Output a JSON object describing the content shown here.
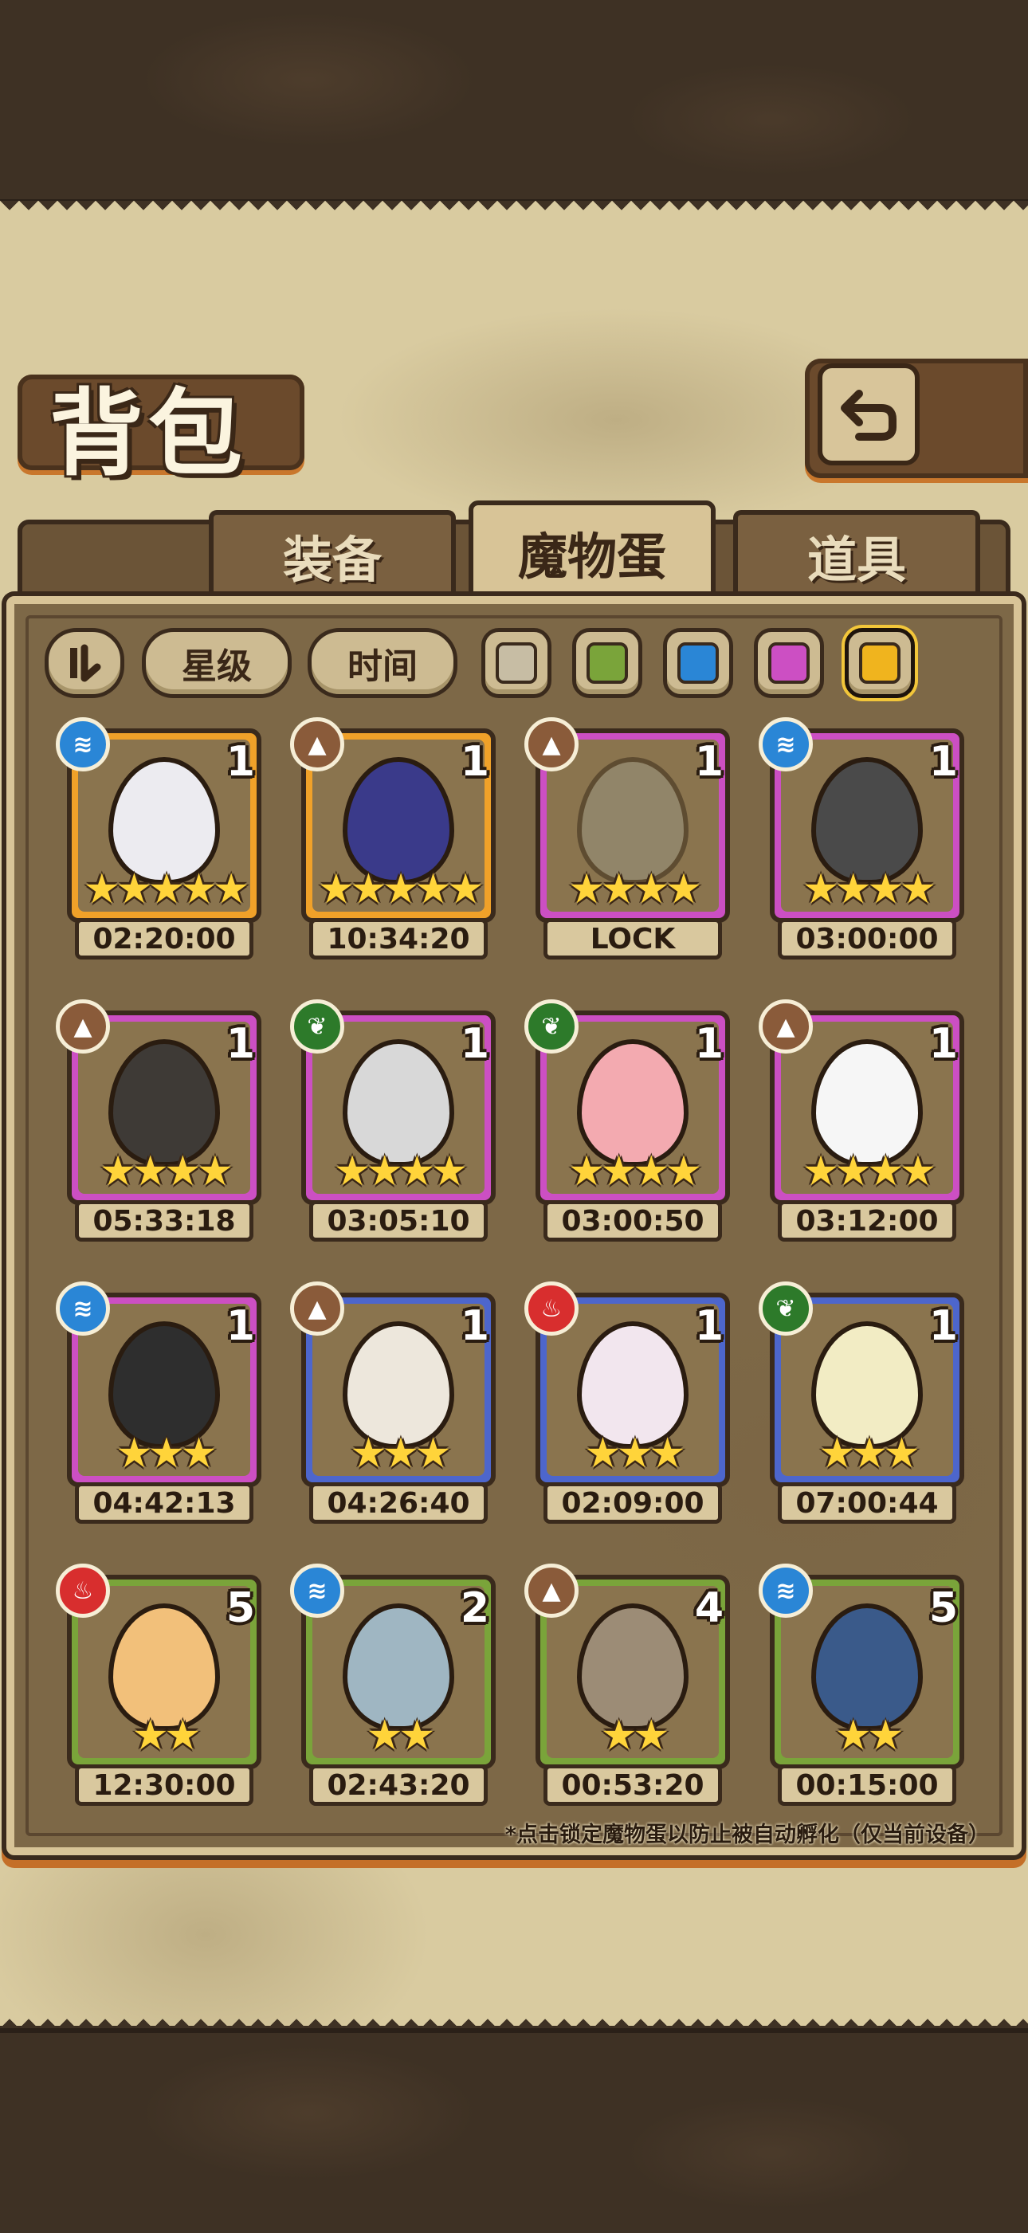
{
  "header": {
    "title": "背包",
    "back_icon": "back-arrow-icon"
  },
  "tabs": [
    {
      "label": "装备",
      "active": false
    },
    {
      "label": "魔物蛋",
      "active": true
    },
    {
      "label": "道具",
      "active": false
    }
  ],
  "filters": {
    "toggle_icon": "pause-sort-icon",
    "star_label": "星级",
    "time_label": "时间",
    "swatches": [
      {
        "name": "grey",
        "color": "#c7bda4"
      },
      {
        "name": "green",
        "color": "#7aa43a"
      },
      {
        "name": "blue",
        "color": "#2a86d6"
      },
      {
        "name": "pink",
        "color": "#cc4fc3"
      },
      {
        "name": "gold",
        "color": "#f0b41e",
        "selected": true
      }
    ]
  },
  "eggs": [
    {
      "element": "water",
      "rarity": "gold",
      "count": "1",
      "stars": "★★★★★",
      "timer": "02:20:00",
      "egg_color": "#ecebf0"
    },
    {
      "element": "earth",
      "rarity": "gold",
      "count": "1",
      "stars": "★★★★★",
      "timer": "10:34:20",
      "egg_color": "#3a3a8a"
    },
    {
      "element": "earth",
      "rarity": "purple",
      "count": "1",
      "stars": "★★★★",
      "timer": "LOCK",
      "egg_color": "#9a9a8a",
      "locked": true
    },
    {
      "element": "water",
      "rarity": "purple",
      "count": "1",
      "stars": "★★★★",
      "timer": "03:00:00",
      "egg_color": "#4a4a4a"
    },
    {
      "element": "earth",
      "rarity": "purple",
      "count": "1",
      "stars": "★★★★",
      "timer": "05:33:18",
      "egg_color": "#3e3a36"
    },
    {
      "element": "nature",
      "rarity": "purple",
      "count": "1",
      "stars": "★★★★",
      "timer": "03:05:10",
      "egg_color": "#d8d8d8"
    },
    {
      "element": "nature",
      "rarity": "purple",
      "count": "1",
      "stars": "★★★★",
      "timer": "03:00:50",
      "egg_color": "#f3aab0"
    },
    {
      "element": "earth",
      "rarity": "purple",
      "count": "1",
      "stars": "★★★★",
      "timer": "03:12:00",
      "egg_color": "#f6f6f6"
    },
    {
      "element": "water",
      "rarity": "purple",
      "count": "1",
      "stars": "★★★",
      "timer": "04:42:13",
      "egg_color": "#2e2e2e"
    },
    {
      "element": "earth",
      "rarity": "blue",
      "count": "1",
      "stars": "★★★",
      "timer": "04:26:40",
      "egg_color": "#ede7dc"
    },
    {
      "element": "fire",
      "rarity": "blue",
      "count": "1",
      "stars": "★★★",
      "timer": "02:09:00",
      "egg_color": "#f2e6ee"
    },
    {
      "element": "nature",
      "rarity": "blue",
      "count": "1",
      "stars": "★★★",
      "timer": "07:00:44",
      "egg_color": "#f2ecc4"
    },
    {
      "element": "fire",
      "rarity": "green",
      "count": "5",
      "stars": "★★",
      "timer": "12:30:00",
      "egg_color": "#f2c07a"
    },
    {
      "element": "water",
      "rarity": "green",
      "count": "2",
      "stars": "★★",
      "timer": "02:43:20",
      "egg_color": "#9fb6c2"
    },
    {
      "element": "earth",
      "rarity": "green",
      "count": "4",
      "stars": "★★",
      "timer": "00:53:20",
      "egg_color": "#9c8c76"
    },
    {
      "element": "water",
      "rarity": "green",
      "count": "5",
      "stars": "★★",
      "timer": "00:15:00",
      "egg_color": "#3a5a8a"
    }
  ],
  "note": "*点击锁定魔物蛋以防止被自动孵化（仅当前设备）"
}
